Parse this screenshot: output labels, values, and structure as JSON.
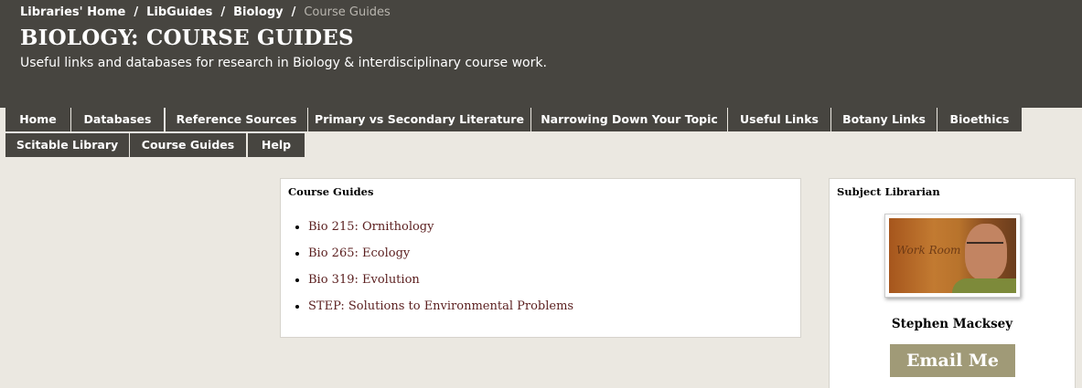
{
  "breadcrumb": {
    "items": [
      "Libraries' Home",
      "LibGuides",
      "Biology"
    ],
    "separator": "/",
    "current": "Course Guides"
  },
  "header": {
    "title": "BIOLOGY: COURSE GUIDES",
    "subtitle": "Useful links and databases for research in Biology & interdisciplinary course work."
  },
  "nav": {
    "tabs": [
      {
        "label": "Home"
      },
      {
        "label": "Databases"
      },
      {
        "label": "Reference Sources"
      },
      {
        "label": "Primary vs Secondary Literature"
      },
      {
        "label": "Narrowing Down Your Topic"
      },
      {
        "label": "Useful Links"
      },
      {
        "label": "Botany Links"
      },
      {
        "label": "Bioethics"
      },
      {
        "label": "Scitable Library"
      },
      {
        "label": "Course Guides"
      },
      {
        "label": "Help"
      }
    ]
  },
  "course_guides": {
    "title": "Course Guides",
    "items": [
      {
        "label": "Bio 215: Ornithology"
      },
      {
        "label": "Bio 265: Ecology"
      },
      {
        "label": "Bio 319: Evolution"
      },
      {
        "label": "STEP: Solutions to Environmental Problems"
      }
    ]
  },
  "subject_librarian": {
    "title": "Subject Librarian",
    "name": "Stephen Macksey",
    "email_label": "Email Me",
    "photo_sign_text": "Work Room"
  },
  "colors": {
    "header_bg": "#474540",
    "page_bg": "#ebe8e1",
    "link": "#5a1e1e",
    "email_button": "#a09a77"
  }
}
